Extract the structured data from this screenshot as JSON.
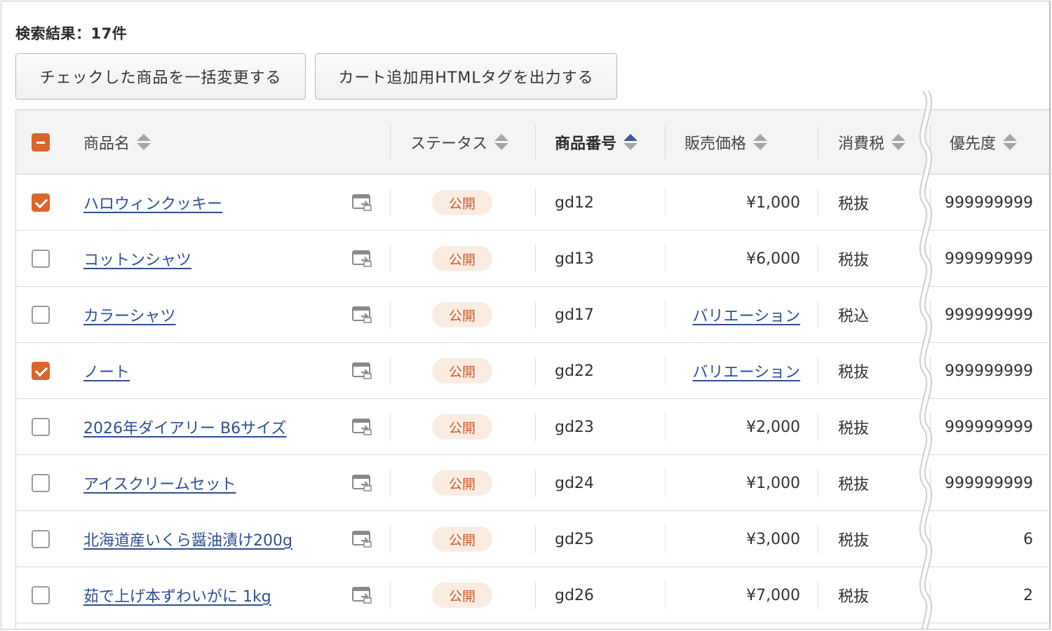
{
  "result_count": "検索結果：17件",
  "buttons": {
    "bulk_change": "チェックした商品を一括変更する",
    "cart_html": "カート追加用HTMLタグを出力する"
  },
  "columns": {
    "name": "商品名",
    "status": "ステータス",
    "number": "商品番号",
    "price": "販売価格",
    "tax": "消費税",
    "priority": "優先度"
  },
  "colors": {
    "accent": "#d9662c",
    "link": "#2f4f8f",
    "status_bg": "#fbece2",
    "status_text": "#c85a2a",
    "sort_active": "#3c5a9a"
  },
  "icons": {
    "sort": "sort-arrows-icon",
    "preview": "preview-window-icon",
    "checkbox": "checkbox-icon"
  },
  "rows": [
    {
      "checked": true,
      "name": "ハロウィンクッキー",
      "status": "公開",
      "number": "gd12",
      "price": "¥1,000",
      "price_is_link": false,
      "tax": "税抜",
      "priority": "999999999"
    },
    {
      "checked": false,
      "name": "コットンシャツ",
      "status": "公開",
      "number": "gd13",
      "price": "¥6,000",
      "price_is_link": false,
      "tax": "税抜",
      "priority": "999999999"
    },
    {
      "checked": false,
      "name": "カラーシャツ",
      "status": "公開",
      "number": "gd17",
      "price": "バリエーション",
      "price_is_link": true,
      "tax": "税込",
      "priority": "999999999"
    },
    {
      "checked": true,
      "name": "ノート",
      "status": "公開",
      "number": "gd22",
      "price": "バリエーション",
      "price_is_link": true,
      "tax": "税抜",
      "priority": "999999999"
    },
    {
      "checked": false,
      "name": "2026年ダイアリー B6サイズ",
      "status": "公開",
      "number": "gd23",
      "price": "¥2,000",
      "price_is_link": false,
      "tax": "税抜",
      "priority": "999999999"
    },
    {
      "checked": false,
      "name": "アイスクリームセット",
      "status": "公開",
      "number": "gd24",
      "price": "¥1,000",
      "price_is_link": false,
      "tax": "税抜",
      "priority": "999999999"
    },
    {
      "checked": false,
      "name": "北海道産いくら醤油漬け200g",
      "status": "公開",
      "number": "gd25",
      "price": "¥3,000",
      "price_is_link": false,
      "tax": "税抜",
      "priority": "6"
    },
    {
      "checked": false,
      "name": "茹で上げ本ずわいがに 1kg",
      "status": "公開",
      "number": "gd26",
      "price": "¥7,000",
      "price_is_link": false,
      "tax": "税抜",
      "priority": "2"
    }
  ]
}
